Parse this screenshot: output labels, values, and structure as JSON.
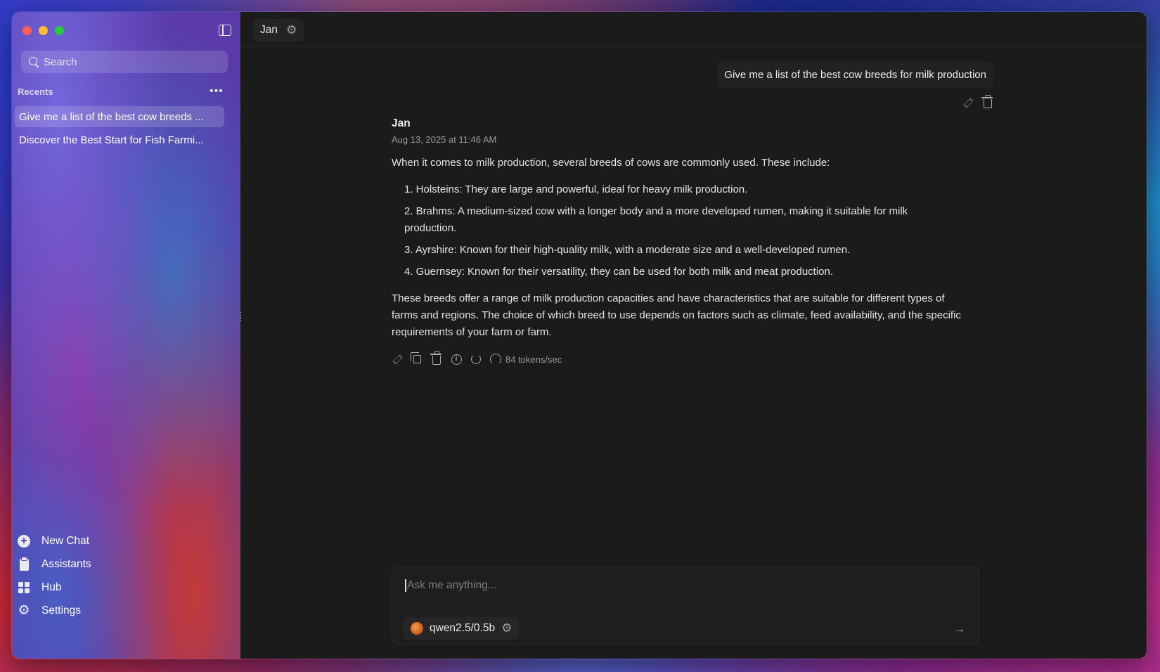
{
  "sidebar": {
    "search_placeholder": "Search",
    "recents_label": "Recents",
    "recents_more": "•••",
    "recents": [
      {
        "label": "Give me a list of the best cow breeds ...",
        "active": true
      },
      {
        "label": "Discover the Best Start for Fish Farmi...",
        "active": false
      }
    ],
    "nav": [
      {
        "label": "New Chat",
        "icon": "plus-circle-icon"
      },
      {
        "label": "Assistants",
        "icon": "clipboard-icon"
      },
      {
        "label": "Hub",
        "icon": "grid-icon"
      },
      {
        "label": "Settings",
        "icon": "gear-icon"
      }
    ]
  },
  "topbar": {
    "assistant_name": "Jan"
  },
  "conversation": {
    "user_message": "Give me a list of the best cow breeds for milk production",
    "assistant": {
      "name": "Jan",
      "timestamp": "Aug 13, 2025 at 11:46 AM",
      "intro": "When it comes to milk production, several breeds of cows are commonly used. These include:",
      "items": [
        "1. Holsteins: They are large and powerful, ideal for heavy milk production.",
        "2. Brahms: A medium-sized cow with a longer body and a more developed rumen, making it suitable for milk production.",
        "3. Ayrshire: Known for their high-quality milk, with a moderate size and a well-developed rumen.",
        "4. Guernsey: Known for their versatility, they can be used for both milk and meat production."
      ],
      "outro": "These breeds offer a range of milk production capacities and have characteristics that are suitable for different types of farms and regions. The choice of which breed to use depends on factors such as climate, feed availability, and the specific requirements of your farm or farm.",
      "speed": "84 tokens/sec"
    }
  },
  "composer": {
    "placeholder": "Ask me anything...",
    "model": "qwen2.5/0.5b"
  },
  "colors": {
    "main_bg": "#1b1b1b",
    "traffic_red": "#fe5f57",
    "traffic_yellow": "#febc2e",
    "traffic_green": "#28c840"
  }
}
